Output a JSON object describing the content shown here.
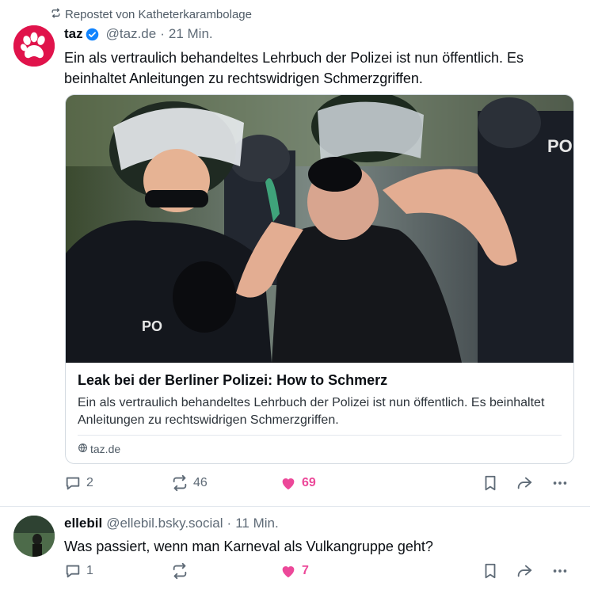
{
  "colors": {
    "like_pink": "#ec4899",
    "muted": "#5f6b77",
    "brand_taz": "#e0134b",
    "verified_blue": "#1083fe"
  },
  "post1": {
    "repost_label": "Repostet von Katheterkarambolage",
    "author": {
      "name": "taz",
      "handle": "@taz.de",
      "verified": true
    },
    "separator": "·",
    "time": "21 Min.",
    "text": "Ein als vertraulich behandeltes Lehrbuch der Polizei ist nun öffentlich. Es beinhaltet Anleitungen zu rechtswidrigen Schmerzgriffen.",
    "card": {
      "title": "Leak bei der Berliner Polizei: How to Schmerz",
      "description": "Ein als vertraulich behandeltes Lehrbuch der Polizei ist nun öffentlich. Es beinhaltet Anleitungen zu rechtswidrigen Schmerzgriffen.",
      "domain": "taz.de",
      "image_badge_left": "PO",
      "image_badge_right": "POL"
    },
    "stats": {
      "replies": "2",
      "reposts": "46",
      "likes": "69"
    }
  },
  "post2": {
    "author": {
      "name": "ellebil",
      "handle": "@ellebil.bsky.social"
    },
    "separator": "·",
    "time": "11 Min.",
    "text": "Was passiert, wenn man Karneval als Vulkangruppe geht?",
    "stats": {
      "replies": "1",
      "reposts": "",
      "likes": "7"
    }
  },
  "icons": [
    "repost-icon",
    "verified-icon",
    "reply-icon",
    "heart-icon",
    "bookmark-icon",
    "share-icon",
    "more-icon",
    "globe-icon"
  ]
}
